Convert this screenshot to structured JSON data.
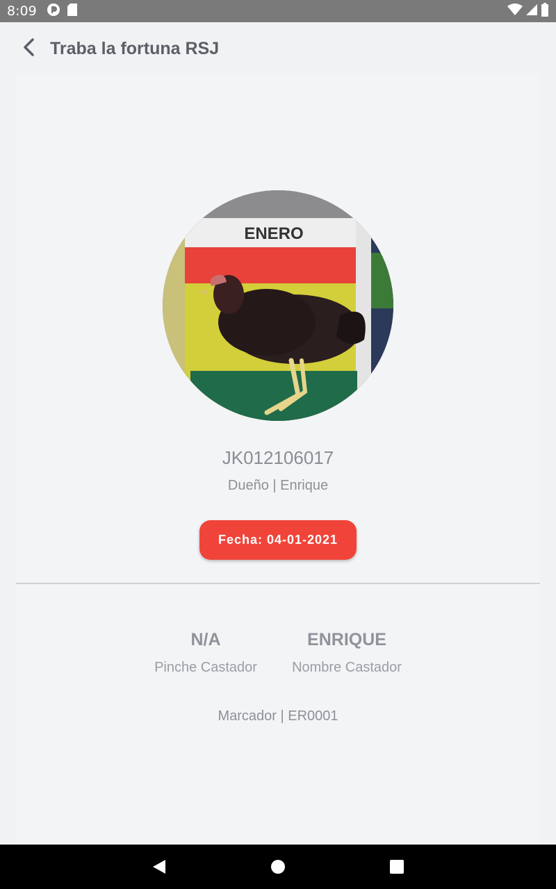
{
  "status_bar": {
    "time": "8:09",
    "left_icons": [
      "notification-app-icon",
      "sd-card-icon"
    ],
    "right_icons": [
      "wifi-icon",
      "cell-signal-icon",
      "battery-icon"
    ]
  },
  "header": {
    "title": "Traba la fortuna RSJ",
    "back_icon": "chevron-left-icon"
  },
  "profile": {
    "photo_text": "ENERO",
    "code": "JK012106017",
    "owner": "Dueño | Enrique",
    "date_badge": "Fecha: 04-01-2021"
  },
  "details": {
    "pinche_value": "N/A",
    "pinche_label": "Pinche Castador",
    "nombre_value": "ENRIQUE",
    "nombre_label": "Nombre Castador",
    "marker": "Marcador | ER0001"
  },
  "nav": {
    "buttons": [
      "back-triangle-icon",
      "home-circle-icon",
      "recents-square-icon"
    ]
  },
  "colors": {
    "badge": "#f0443a",
    "status_bar": "#7a7a7a",
    "nav_bar": "#000000"
  }
}
